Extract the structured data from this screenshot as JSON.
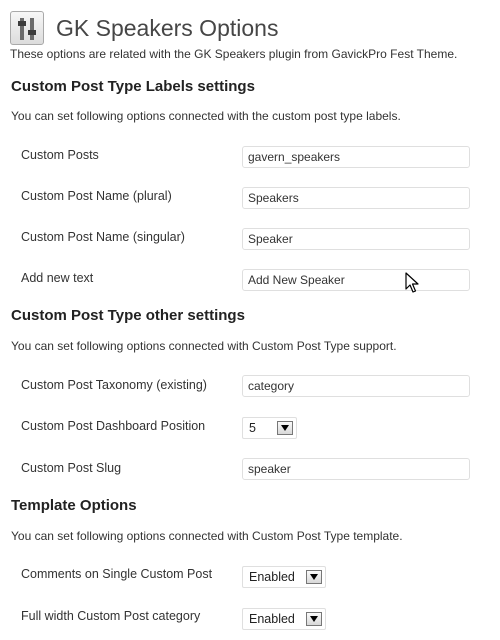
{
  "header": {
    "title": "GK Speakers Options",
    "icon": "settings-sliders-icon",
    "intro": "These options are related with the GK Speakers plugin from GavickPro Fest Theme."
  },
  "labels_section": {
    "title": "Custom Post Type Labels settings",
    "description": "You can set following options connected with the custom post type labels.",
    "custom_posts": {
      "label": "Custom Posts",
      "value": "gavern_speakers"
    },
    "name_plural": {
      "label": "Custom Post Name (plural)",
      "value": "Speakers"
    },
    "name_singular": {
      "label": "Custom Post Name (singular)",
      "value": "Speaker"
    },
    "add_new": {
      "label": "Add new text",
      "value": "Add New Speaker"
    }
  },
  "other_section": {
    "title": "Custom Post Type other settings",
    "description": "You can set following options connected with Custom Post Type support.",
    "taxonomy": {
      "label": "Custom Post Taxonomy (existing)",
      "value": "category"
    },
    "dashboard_position": {
      "label": "Custom Post Dashboard Position",
      "selected": "5"
    },
    "slug": {
      "label": "Custom Post Slug",
      "value": "speaker"
    }
  },
  "template_section": {
    "title": "Template Options",
    "description": "You can set following options connected with Custom Post Type template.",
    "comments_single": {
      "label": "Comments on Single Custom Post",
      "selected": "Enabled"
    },
    "full_width_category": {
      "label": "Full width Custom Post category",
      "selected": "Enabled"
    }
  }
}
